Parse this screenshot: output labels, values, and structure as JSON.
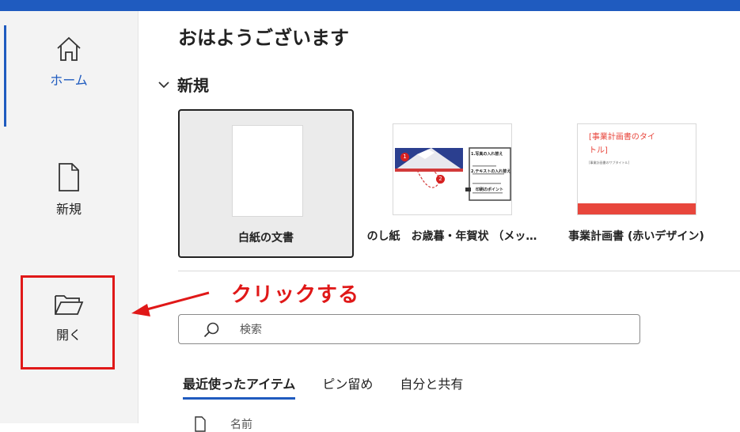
{
  "nav": {
    "home_label": "ホーム",
    "new_label": "新規",
    "open_label": "開く"
  },
  "greeting": "おはようございます",
  "new_section": {
    "title": "新規",
    "templates": [
      {
        "name": "白紙の文書"
      },
      {
        "name": "のし紙　お歳暮・年賀状 （メッ…"
      },
      {
        "name": "事業計画書 (赤いデザイン)"
      }
    ],
    "thumb2": {
      "badge1": "1",
      "badge2": "2",
      "head1": "1.写真の入れ替え",
      "head2": "2.テキストの入れ替え",
      "head3": "印刷のポイント"
    },
    "thumb3": {
      "title_line1": "[事業計画書のタイ",
      "title_line2": "トル]",
      "sub": "[事業計画書のサブタイトル]"
    }
  },
  "annotation": {
    "callout": "クリックする"
  },
  "search": {
    "placeholder": "検索"
  },
  "tabs": [
    {
      "label": "最近使ったアイテム"
    },
    {
      "label": "ピン留め"
    },
    {
      "label": "自分と共有"
    }
  ],
  "list": {
    "header_name": "名前"
  },
  "colors": {
    "accent": "#1f5bbf",
    "annotation_red": "#e01818"
  }
}
